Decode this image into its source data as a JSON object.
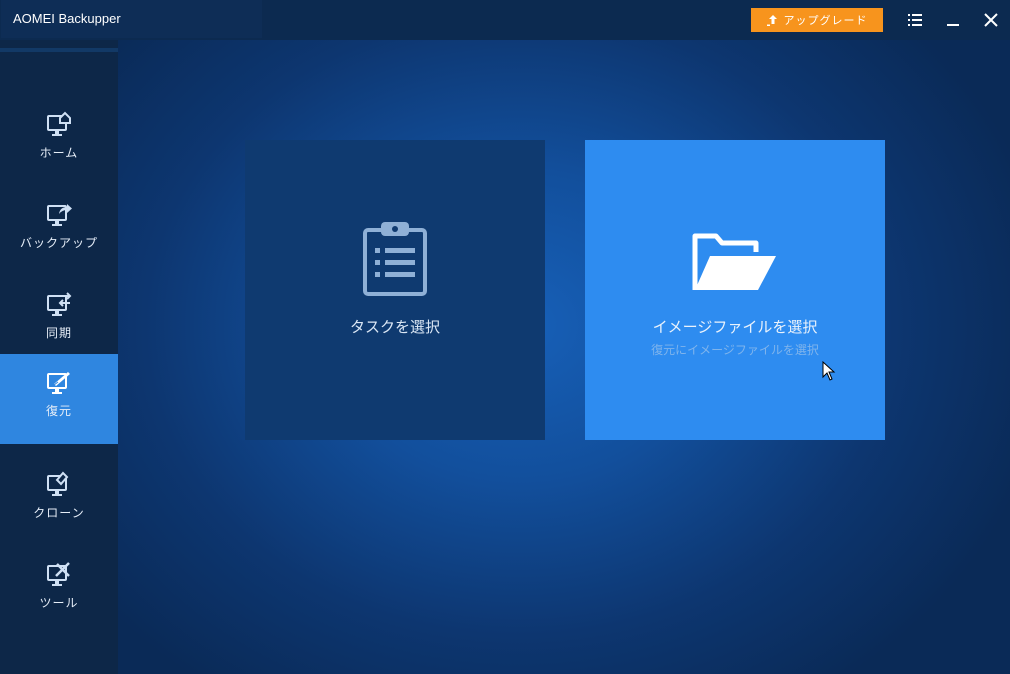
{
  "app": {
    "title": "AOMEI Backupper"
  },
  "header": {
    "upgrade_label": "アップグレード"
  },
  "sidebar": {
    "items": [
      {
        "label": "ホーム",
        "icon": "home-monitor-icon"
      },
      {
        "label": "バックアップ",
        "icon": "backup-monitor-icon"
      },
      {
        "label": "同期",
        "icon": "sync-monitor-icon"
      },
      {
        "label": "復元",
        "icon": "restore-monitor-icon",
        "active": true
      },
      {
        "label": "クローン",
        "icon": "clone-monitor-icon"
      },
      {
        "label": "ツール",
        "icon": "tools-monitor-icon"
      }
    ]
  },
  "main": {
    "cards": [
      {
        "title": "タスクを選択",
        "icon": "clipboard-icon"
      },
      {
        "title": "イメージファイルを選択",
        "subtitle": "復元にイメージファイルを選択",
        "icon": "folder-icon"
      }
    ]
  },
  "colors": {
    "accent": "#2e8cf0",
    "upgrade": "#f7941d",
    "sidebar": "#0d2748"
  }
}
